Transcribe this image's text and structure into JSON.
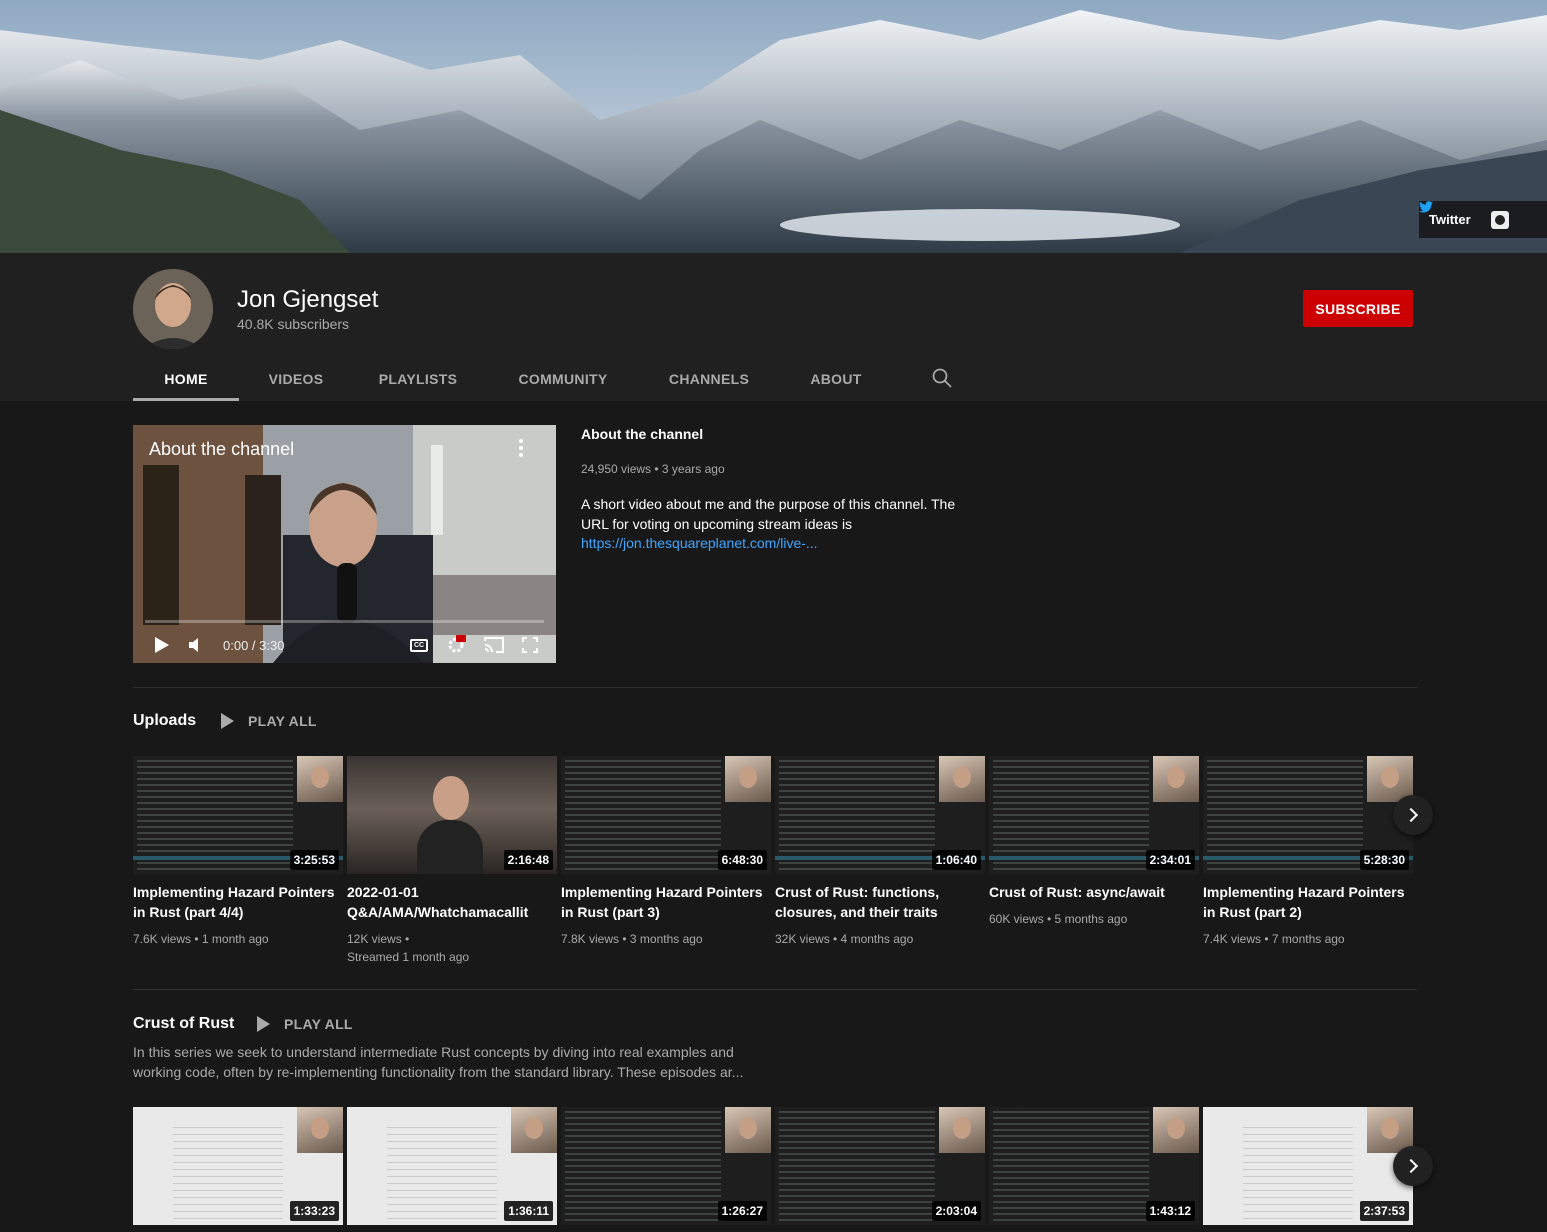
{
  "banner": {
    "links": [
      {
        "label": "Twitter",
        "icon": "twitter-icon"
      },
      {
        "label": "",
        "icon": "github-icon"
      }
    ]
  },
  "channel": {
    "name": "Jon Gjengset",
    "subscribers": "40.8K subscribers",
    "subscribe_label": "SUBSCRIBE",
    "tabs": [
      "HOME",
      "VIDEOS",
      "PLAYLISTS",
      "COMMUNITY",
      "CHANNELS",
      "ABOUT"
    ],
    "active_tab": "HOME"
  },
  "featured": {
    "video_title": "About the channel",
    "time": "0:00 / 3:30",
    "title": "About the channel",
    "views": "24,950 views",
    "age": "3 years ago",
    "description": "A short video about me and the purpose of this channel. The URL for voting on upcoming stream ideas is",
    "link": "https://jon.thesquareplanet.com/live-..."
  },
  "uploads": {
    "title": "Uploads",
    "play_all": "PLAY ALL",
    "videos": [
      {
        "title": "Implementing Hazard Pointers in Rust (part 4/4)",
        "duration": "3:25:53",
        "meta": "7.6K views • 1 month ago",
        "meta2": ""
      },
      {
        "title": "2022-01-01 Q&A/AMA/Whatchamacallit",
        "duration": "2:16:48",
        "meta": "12K views •",
        "meta2": "Streamed 1 month ago"
      },
      {
        "title": "Implementing Hazard Pointers in Rust (part 3)",
        "duration": "6:48:30",
        "meta": "7.8K views • 3 months ago",
        "meta2": ""
      },
      {
        "title": "Crust of Rust: functions, closures, and their traits",
        "duration": "1:06:40",
        "meta": "32K views • 4 months ago",
        "meta2": ""
      },
      {
        "title": "Crust of Rust: async/await",
        "duration": "2:34:01",
        "meta": "60K views • 5 months ago",
        "meta2": ""
      },
      {
        "title": "Implementing Hazard Pointers in Rust (part 2)",
        "duration": "5:28:30",
        "meta": "7.4K views • 7 months ago",
        "meta2": ""
      }
    ]
  },
  "crust": {
    "title": "Crust of Rust",
    "play_all": "PLAY ALL",
    "description": "In this series we seek to understand intermediate Rust concepts by diving into real examples and working code, often by re-implementing functionality from the standard library. These episodes ar...",
    "videos": [
      {
        "duration": "1:33:23"
      },
      {
        "duration": "1:36:11"
      },
      {
        "duration": "1:26:27"
      },
      {
        "duration": "2:03:04"
      },
      {
        "duration": "1:43:12"
      },
      {
        "duration": "2:37:53"
      }
    ]
  },
  "colors": {
    "accent_red": "#cc0000",
    "link_blue": "#3ea6ff",
    "background": "#181818",
    "header": "#202020"
  }
}
